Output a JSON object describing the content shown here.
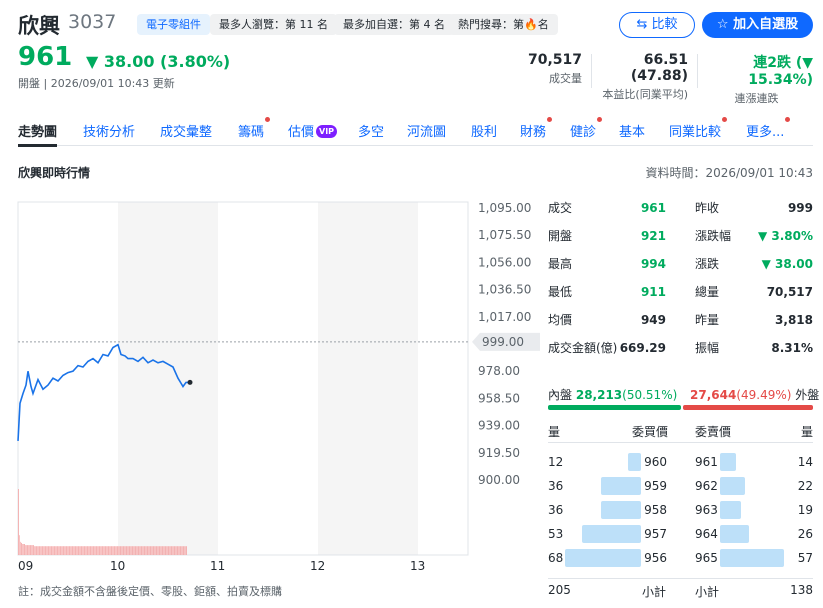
{
  "header": {
    "name": "欣興",
    "code": "3037",
    "badges": [
      "電子零組件",
      "最多人瀏覽：第 11 名",
      "最多加自選：第 4 名",
      "熱門搜尋：第",
      "名"
    ],
    "hot_rank_digit": "6",
    "compare_label": "比較",
    "watch_label": "加入自選股",
    "price": "961",
    "change": "38.00 (3.80%)",
    "status": "開盤 | 2026/09/01 10:43 更新",
    "stats": [
      {
        "value": "70,517",
        "label": "成交量"
      },
      {
        "value": "66.51 (47.88)",
        "label": "本益比(同業平均)"
      },
      {
        "value": "連2跌 (▼ 15.34%)",
        "label": "連漲連跌"
      }
    ]
  },
  "tabs": [
    {
      "label": "走勢圖",
      "dot": false
    },
    {
      "label": "技術分析",
      "dot": false
    },
    {
      "label": "成交彙整",
      "dot": false
    },
    {
      "label": "籌碼",
      "dot": true
    },
    {
      "label": "估價",
      "dot": false,
      "vip": "VIP"
    },
    {
      "label": "多空",
      "dot": false
    },
    {
      "label": "河流圖",
      "dot": false
    },
    {
      "label": "股利",
      "dot": false
    },
    {
      "label": "財務",
      "dot": true
    },
    {
      "label": "健診",
      "dot": true
    },
    {
      "label": "基本",
      "dot": false
    },
    {
      "label": "同業比較",
      "dot": true
    },
    {
      "label": "更多...",
      "dot": true
    }
  ],
  "section": {
    "title": "欣興即時行情",
    "data_time": "資料時間：2026/09/01 10:43"
  },
  "chart_data": {
    "type": "line",
    "y_ticks": [
      "1,095.00",
      "1,075.50",
      "1,056.00",
      "1,036.50",
      "1,017.00",
      "978.00",
      "958.50",
      "939.00",
      "919.50",
      "900.00"
    ],
    "ylim": [
      900,
      1095
    ],
    "x_ticks": [
      "09",
      "10",
      "11",
      "12",
      "13"
    ],
    "reference_value": 999,
    "reference_label": "999.00",
    "price_series": [
      [
        9.0,
        928
      ],
      [
        9.02,
        955
      ],
      [
        9.05,
        962
      ],
      [
        9.08,
        968
      ],
      [
        9.1,
        978
      ],
      [
        9.13,
        967
      ],
      [
        9.15,
        962
      ],
      [
        9.18,
        968
      ],
      [
        9.2,
        972
      ],
      [
        9.25,
        965
      ],
      [
        9.3,
        968
      ],
      [
        9.35,
        973
      ],
      [
        9.4,
        971
      ],
      [
        9.45,
        975
      ],
      [
        9.5,
        977
      ],
      [
        9.55,
        978
      ],
      [
        9.6,
        982
      ],
      [
        9.65,
        981
      ],
      [
        9.7,
        985
      ],
      [
        9.75,
        987
      ],
      [
        9.8,
        984
      ],
      [
        9.85,
        990
      ],
      [
        9.9,
        989
      ],
      [
        9.95,
        995
      ],
      [
        10.0,
        997
      ],
      [
        10.03,
        990
      ],
      [
        10.07,
        989
      ],
      [
        10.1,
        987
      ],
      [
        10.15,
        987
      ],
      [
        10.2,
        985
      ],
      [
        10.25,
        988
      ],
      [
        10.3,
        984
      ],
      [
        10.35,
        986
      ],
      [
        10.4,
        984
      ],
      [
        10.45,
        985
      ],
      [
        10.5,
        983
      ],
      [
        10.55,
        981
      ],
      [
        10.6,
        973
      ],
      [
        10.65,
        967
      ],
      [
        10.68,
        970
      ],
      [
        10.72,
        970
      ]
    ],
    "volume_series": [
      60,
      18,
      12,
      11,
      10,
      10,
      10,
      9,
      9,
      9,
      9,
      9,
      9,
      9,
      9,
      9,
      8,
      8,
      8,
      8,
      8,
      8,
      8,
      8,
      8,
      8,
      8,
      8,
      8,
      8,
      8,
      8,
      8,
      8,
      8,
      8,
      8,
      8,
      8,
      8,
      8,
      8,
      8,
      8,
      8,
      8,
      8,
      8,
      8,
      8,
      8,
      8,
      8,
      8,
      8,
      8,
      8,
      8,
      8,
      8,
      8,
      8,
      8,
      8,
      8,
      8,
      8,
      8,
      8,
      8,
      8,
      8,
      8,
      8,
      8,
      8,
      8,
      8,
      8,
      8,
      8,
      8,
      8,
      8,
      8,
      8,
      8,
      8,
      8,
      8,
      8,
      8,
      8,
      8,
      8,
      8,
      8,
      8,
      8,
      8,
      8,
      8,
      8,
      8,
      8,
      8,
      8,
      8,
      8,
      8,
      8,
      8,
      8,
      8,
      8,
      8,
      8,
      8,
      8,
      8,
      8,
      8,
      8,
      8,
      8,
      8,
      8,
      8,
      8,
      8,
      8,
      8,
      8,
      8,
      8,
      8,
      8,
      8,
      8,
      8,
      8,
      8,
      8,
      8,
      8,
      8,
      8,
      8,
      8,
      8,
      8,
      8,
      8,
      8,
      8,
      8,
      8,
      8,
      8,
      8,
      8,
      8,
      8,
      8,
      8,
      8,
      8,
      8,
      8
    ],
    "grid": true
  },
  "quote": {
    "left": [
      {
        "label": "成交",
        "value": "961",
        "color": "green"
      },
      {
        "label": "開盤",
        "value": "921",
        "color": "green"
      },
      {
        "label": "最高",
        "value": "994",
        "color": "green"
      },
      {
        "label": "最低",
        "value": "911",
        "color": "green"
      },
      {
        "label": "均價",
        "value": "949",
        "color": "normal"
      },
      {
        "label": "成交金額(億)",
        "value": "669.29",
        "color": "normal"
      }
    ],
    "right": [
      {
        "label": "昨收",
        "value": "999",
        "color": "normal"
      },
      {
        "label": "漲跌幅",
        "value": "▼ 3.80%",
        "color": "green"
      },
      {
        "label": "漲跌",
        "value": "▼ 38.00",
        "color": "green"
      },
      {
        "label": "總量",
        "value": "70,517",
        "color": "normal"
      },
      {
        "label": "昨量",
        "value": "3,818",
        "color": "normal"
      },
      {
        "label": "振幅",
        "value": "8.31%",
        "color": "normal"
      }
    ]
  },
  "inner_outer": {
    "inner_label": "內盤",
    "inner_value": "28,213",
    "inner_pct": "(50.51%)",
    "inner_ratio": 0.5051,
    "outer_value": "27,644",
    "outer_pct": "(49.49%)",
    "outer_label": "外盤",
    "colors": {
      "inner": "#00ab5e",
      "outer": "#e44a47"
    }
  },
  "order_book": {
    "headers": {
      "bid_qty": "量",
      "bid_price": "委買價",
      "ask_price": "委賣價",
      "ask_qty": "量"
    },
    "bids": [
      {
        "qty": "12",
        "price": "960",
        "q": 12
      },
      {
        "qty": "36",
        "price": "959",
        "q": 36
      },
      {
        "qty": "36",
        "price": "958",
        "q": 36
      },
      {
        "qty": "53",
        "price": "957",
        "q": 53
      },
      {
        "qty": "68",
        "price": "956",
        "q": 68
      }
    ],
    "asks": [
      {
        "qty": "14",
        "price": "961",
        "q": 14
      },
      {
        "qty": "22",
        "price": "962",
        "q": 22
      },
      {
        "qty": "19",
        "price": "963",
        "q": 19
      },
      {
        "qty": "26",
        "price": "964",
        "q": 26
      },
      {
        "qty": "57",
        "price": "965",
        "q": 57
      }
    ],
    "bid_total": "205",
    "bid_total_label": "小計",
    "ask_total_label": "小計",
    "ask_total": "138"
  },
  "footnote": "註：成交金額不含盤後定價、零股、鉅額、拍賣及標購"
}
